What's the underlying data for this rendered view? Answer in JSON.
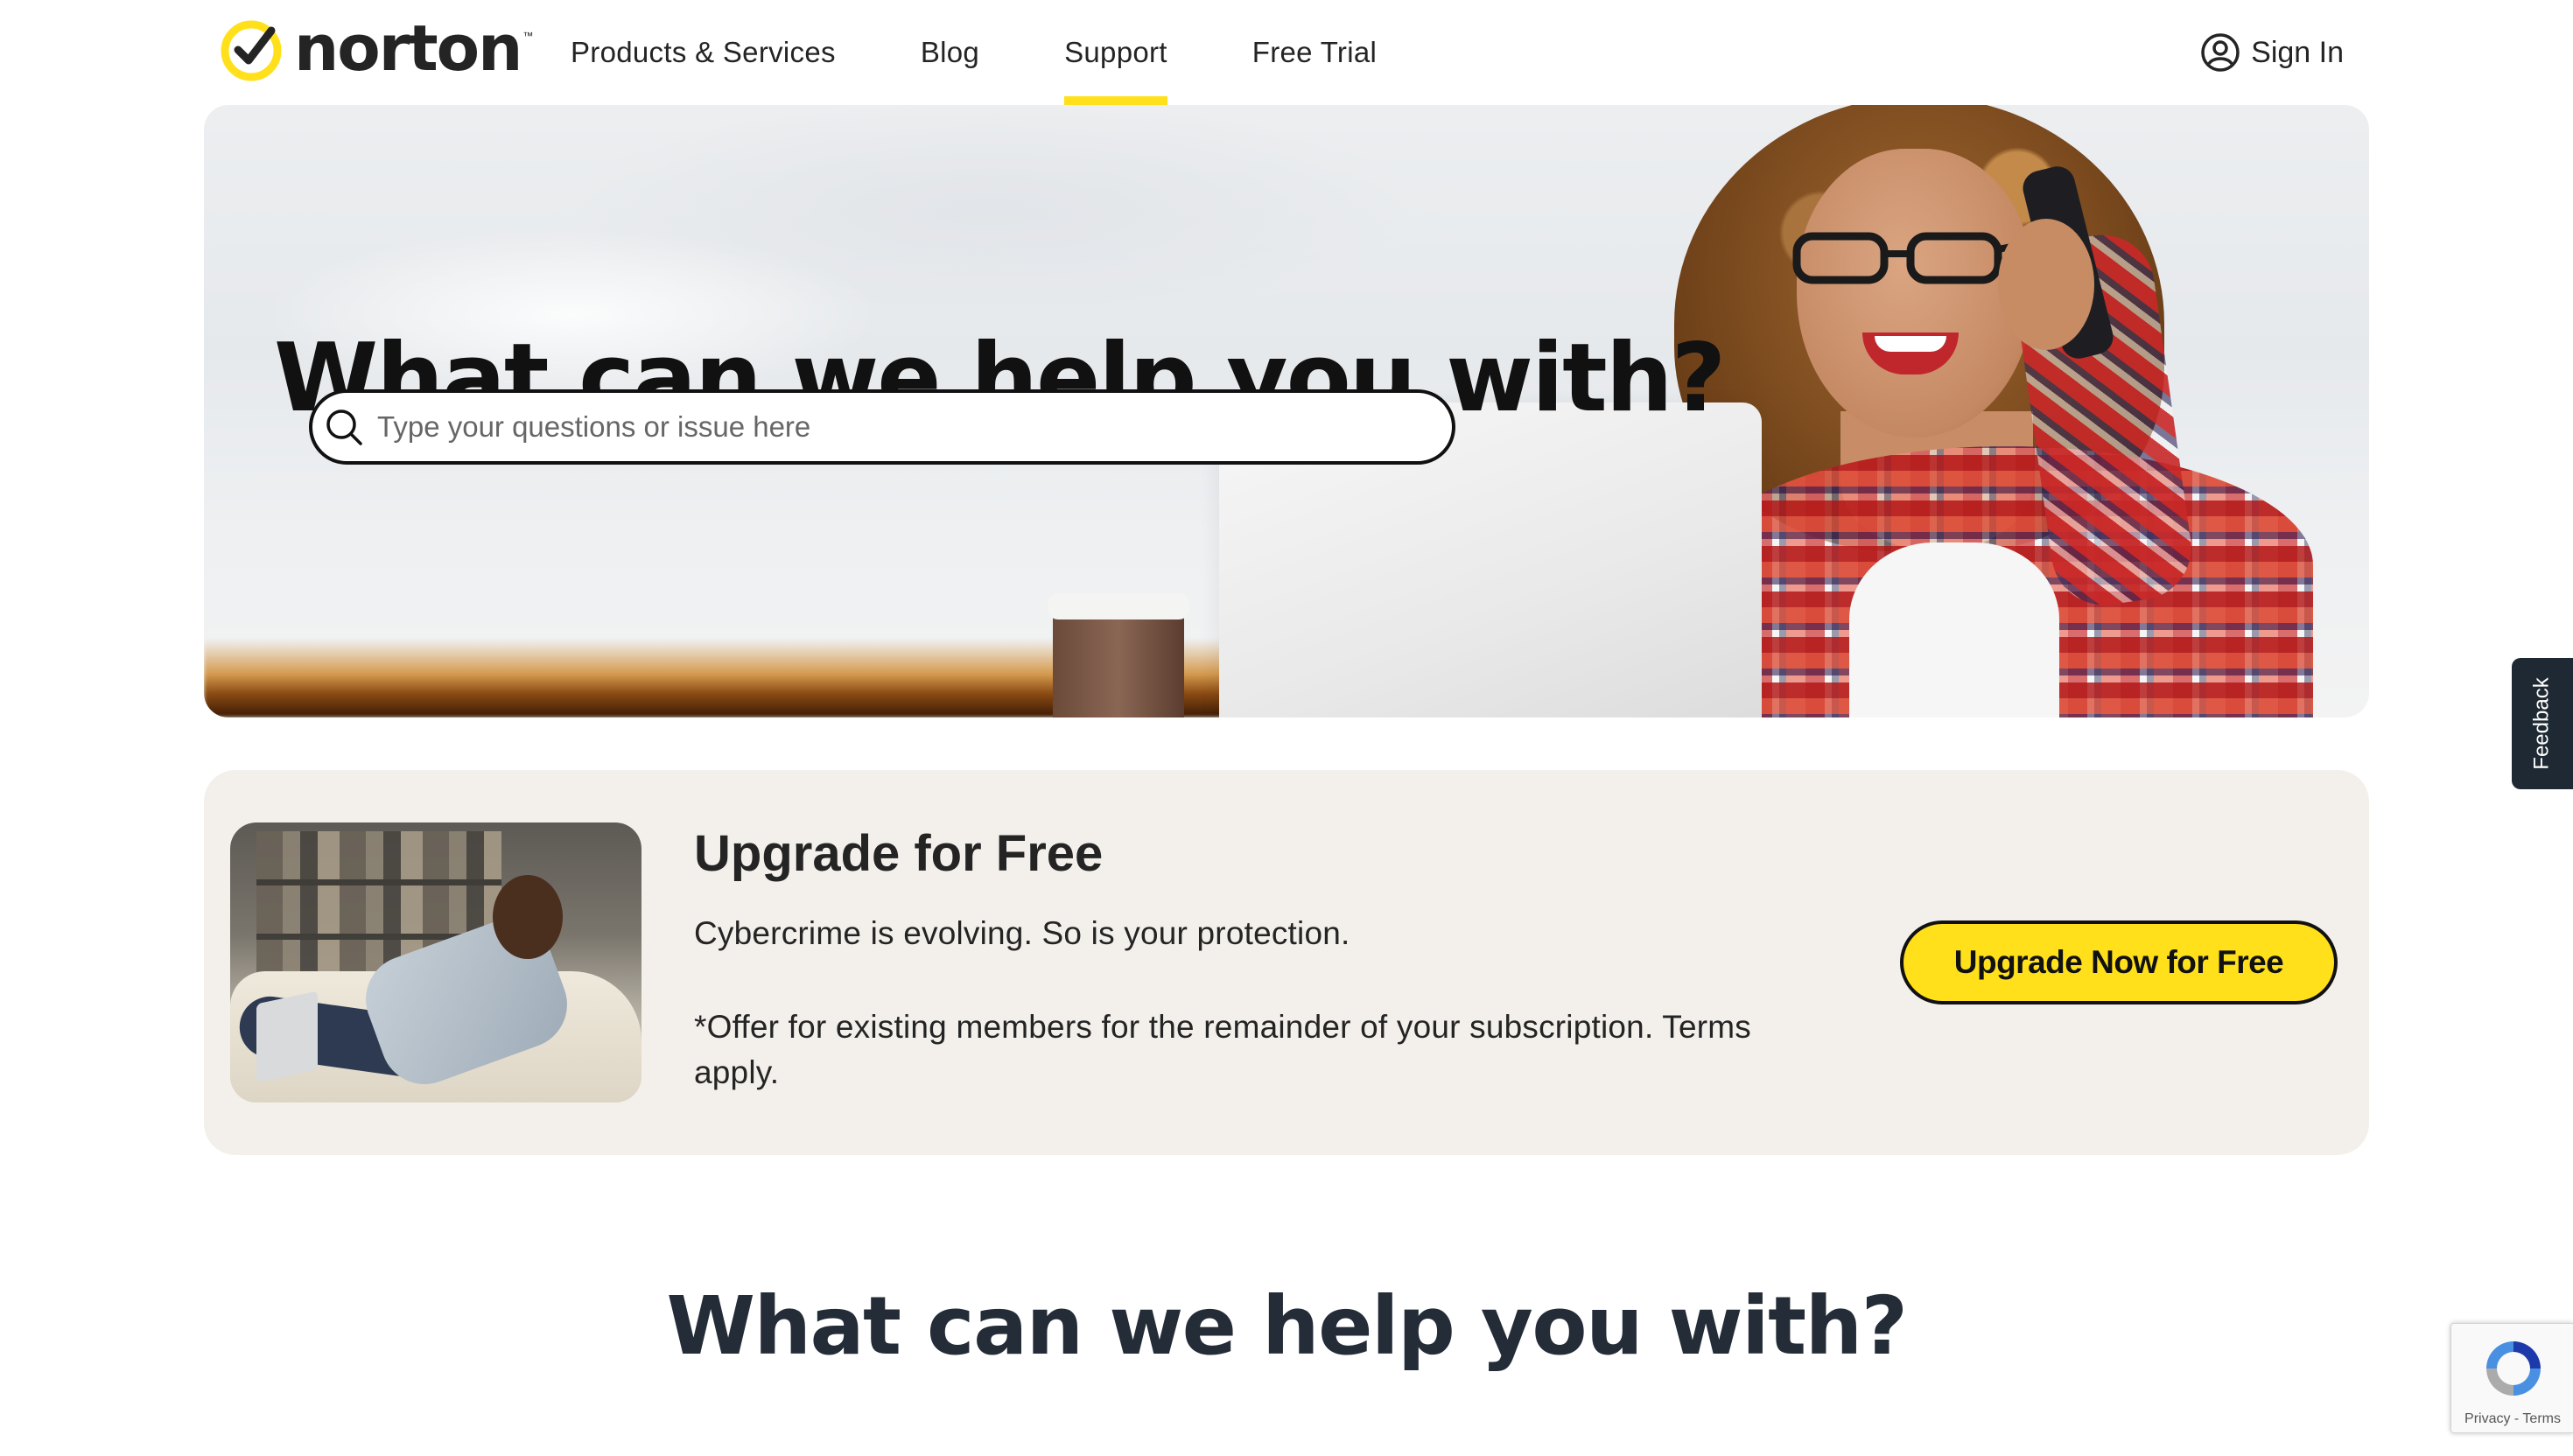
{
  "header": {
    "logo_text": "norton",
    "logo_tm": "™",
    "nav": [
      {
        "label": "Products & Services",
        "active": false
      },
      {
        "label": "Blog",
        "active": false
      },
      {
        "label": "Support",
        "active": true
      },
      {
        "label": "Free Trial",
        "active": false
      }
    ],
    "sign_in_label": "Sign In",
    "accent_color": "#ffe01b"
  },
  "hero": {
    "title": "What can we help you with?",
    "search_placeholder": "Type your questions or issue here",
    "search_value": ""
  },
  "upgrade": {
    "title": "Upgrade for Free",
    "subtitle": "Cybercrime is evolving. So is your protection.",
    "note": "*Offer for existing members for the remainder of your subscription. Terms apply.",
    "button_label": "Upgrade Now for Free"
  },
  "section": {
    "title": "What can we help you with?"
  },
  "feedback_tab": {
    "label": "Feedback"
  },
  "recaptcha": {
    "links": "Privacy - Terms"
  },
  "icons": {
    "logo": "norton-check-icon",
    "sign_in": "user-circle-icon",
    "search": "search-icon",
    "recaptcha": "recaptcha-icon"
  }
}
